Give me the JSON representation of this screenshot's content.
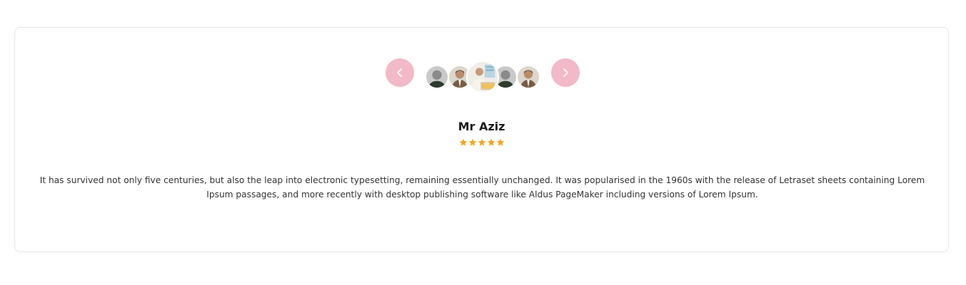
{
  "testimonial": {
    "name": "Mr Aziz",
    "rating": 5,
    "rating_max": 5,
    "text": "It has survived not only five centuries, but also the leap into electronic typesetting, remaining essentially unchanged. It was popularised in the 1960s with the release of Letraset sheets containing Lorem Ipsum passages, and more recently with desktop publishing software like Aldus PageMaker including versions of Lorem Ipsum."
  },
  "carousel": {
    "prev_icon": "chevron-left-icon",
    "next_icon": "chevron-right-icon",
    "active_index": 2,
    "avatar_count": 5
  },
  "colors": {
    "nav_button": "#f2b9c9",
    "star": "#f5a623",
    "text": "#333333",
    "card_border": "#e6e6e6"
  }
}
